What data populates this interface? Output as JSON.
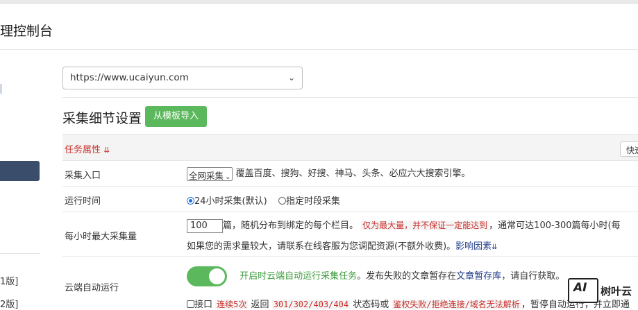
{
  "header": {
    "title": "理控制台"
  },
  "sidebar": {
    "version_1": "1版]",
    "version_2": "2版]"
  },
  "site_select": {
    "value": "https://www.ucaiyun.com"
  },
  "section": {
    "title": "采集细节设置",
    "import_button": "从模板导入"
  },
  "table": {
    "header_label": "任务属性",
    "quick_button": "快速",
    "rows": {
      "entry": {
        "label": "采集入口",
        "select_value": "全网采集",
        "description": "覆盖百度、搜狗、好搜、神马、头条、必应六大搜索引擎。"
      },
      "run_time": {
        "label": "运行时间",
        "option_1": "24小时采集(默认)",
        "option_2": "指定时段采集"
      },
      "max_per_hour": {
        "label": "每小时最大采集量",
        "value": "100",
        "text_1": "篇，随机分布到绑定的每个栏目。",
        "warning": "仅为最大量，并不保证一定能达到",
        "text_2": "，通常可达100-300篇每小时(每",
        "line2_text": "如果您的需求量较大，请联系在线客服为您调配资源(不额外收费)。",
        "link": "影响因素"
      },
      "cloud_run": {
        "label": "云端自动运行",
        "toggle_on": true,
        "green_text": "开启时云端自动运行采集任务",
        "text_1": "。发布失败的文章暂存在",
        "link": "文章暂存库",
        "text_2": "，请自行获取。",
        "checkbox_label": "接口",
        "warn_1": "连续5次",
        "text_3": "返回",
        "code": "301/302/403/404",
        "text_4": "状态码或",
        "code_2": "鉴权失败/拒绝连接/域名无法解析",
        "text_5": "，暂停自动运行，并立即通"
      }
    }
  },
  "watermark": {
    "logo_text": "AI",
    "text": "树叶云"
  }
}
